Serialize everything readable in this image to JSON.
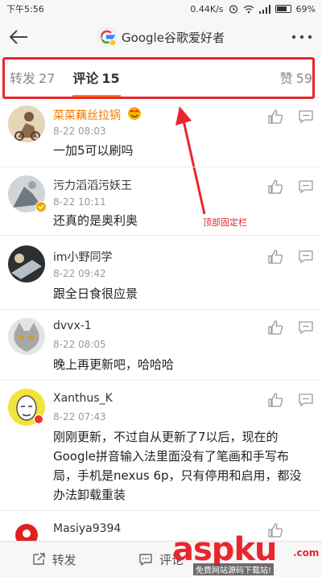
{
  "status_bar": {
    "time": "下午5:56",
    "speed": "0.44K/s",
    "battery": "69%"
  },
  "title_bar": {
    "title": "Google谷歌爱好者"
  },
  "tabs": [
    {
      "label": "转发",
      "count": "27"
    },
    {
      "label": "评论",
      "count": "15"
    },
    {
      "label": "赞",
      "count": "59"
    }
  ],
  "annotation": "顶部固定栏",
  "comments": [
    {
      "name": "菜菜藕丝拉锅",
      "time": "8-22 08:03",
      "text": "一加5可以刷吗"
    },
    {
      "name": "污力滔滔污妖王",
      "time": "8-22 10:11",
      "text": "还真的是奥利奥"
    },
    {
      "name": "im小野同学",
      "time": "8-22 09:42",
      "text": "跟全日食很应景"
    },
    {
      "name": "dvvx-1",
      "time": "8-22 08:05",
      "text": "晚上再更新吧，哈哈哈"
    },
    {
      "name": "Xanthus_K",
      "time": "8-22 07:43",
      "text": "刚刚更新，不过自从更新了7以后，现在的Google拼音输入法里面没有了笔画和手写布局，手机是nexus 6p，只有停用和启用，都没办法卸载重装"
    },
    {
      "name": "Masiya9394",
      "time": "",
      "text": ""
    }
  ],
  "bottom_bar": {
    "repost": "转发",
    "comment": "评论"
  },
  "watermark": {
    "logo_a": "asp",
    "logo_b": "ku",
    "dotcom": ".com",
    "sub": "免费网站源码下载站!"
  }
}
